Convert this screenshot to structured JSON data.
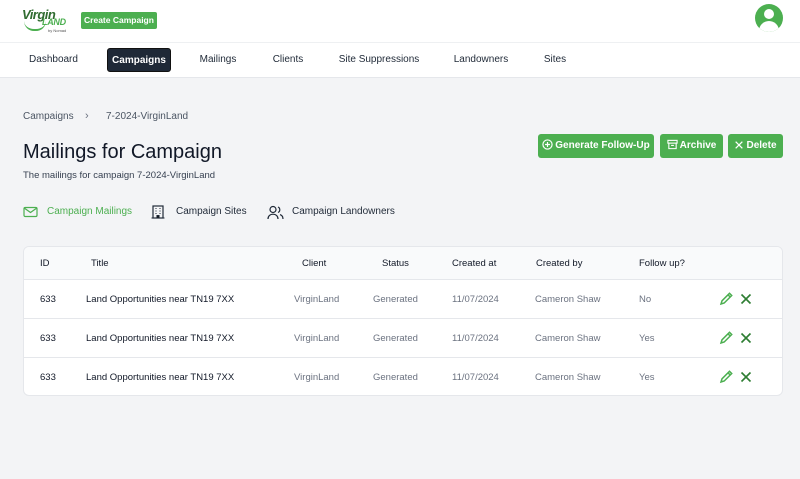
{
  "logo": {
    "line1": "Virgin",
    "line2": "LAND",
    "line3": "by Nomad"
  },
  "header": {
    "create_label": "Create Campaign"
  },
  "nav": {
    "items": [
      {
        "label": "Dashboard",
        "active": false
      },
      {
        "label": "Campaigns",
        "active": true
      },
      {
        "label": "Mailings",
        "active": false
      },
      {
        "label": "Clients",
        "active": false
      },
      {
        "label": "Site Suppressions",
        "active": false
      },
      {
        "label": "Landowners",
        "active": false
      },
      {
        "label": "Sites",
        "active": false
      }
    ]
  },
  "breadcrumb": {
    "items": [
      "Campaigns",
      "7-2024-VirginLand"
    ],
    "separator": "›"
  },
  "page": {
    "title": "Mailings for Campaign",
    "subtitle": "The mailings for campaign 7-2024-VirginLand"
  },
  "actions": {
    "follow_up": "Generate Follow-Up",
    "archive": "Archive",
    "delete": "Delete"
  },
  "tabs": [
    {
      "label": "Campaign Mailings",
      "icon": "envelope-icon",
      "active": true
    },
    {
      "label": "Campaign Sites",
      "icon": "building-icon",
      "active": false
    },
    {
      "label": "Campaign Landowners",
      "icon": "users-icon",
      "active": false
    }
  ],
  "table": {
    "columns": [
      "ID",
      "Title",
      "Client",
      "Status",
      "Created at",
      "Created by",
      "Follow up?"
    ],
    "rows": [
      {
        "id": "633",
        "title": "Land Opportunities near TN19 7XX",
        "client": "VirginLand",
        "status": "Generated",
        "created_at": "11/07/2024",
        "created_by": "Cameron Shaw",
        "follow_up": "No"
      },
      {
        "id": "633",
        "title": "Land Opportunities near TN19 7XX",
        "client": "VirginLand",
        "status": "Generated",
        "created_at": "11/07/2024",
        "created_by": "Cameron Shaw",
        "follow_up": "Yes"
      },
      {
        "id": "633",
        "title": "Land Opportunities near TN19 7XX",
        "client": "VirginLand",
        "status": "Generated",
        "created_at": "11/07/2024",
        "created_by": "Cameron Shaw",
        "follow_up": "Yes"
      }
    ]
  },
  "colors": {
    "accent": "#4caf50",
    "nav_active_bg": "#1f2937",
    "background": "#f3f4f6"
  }
}
